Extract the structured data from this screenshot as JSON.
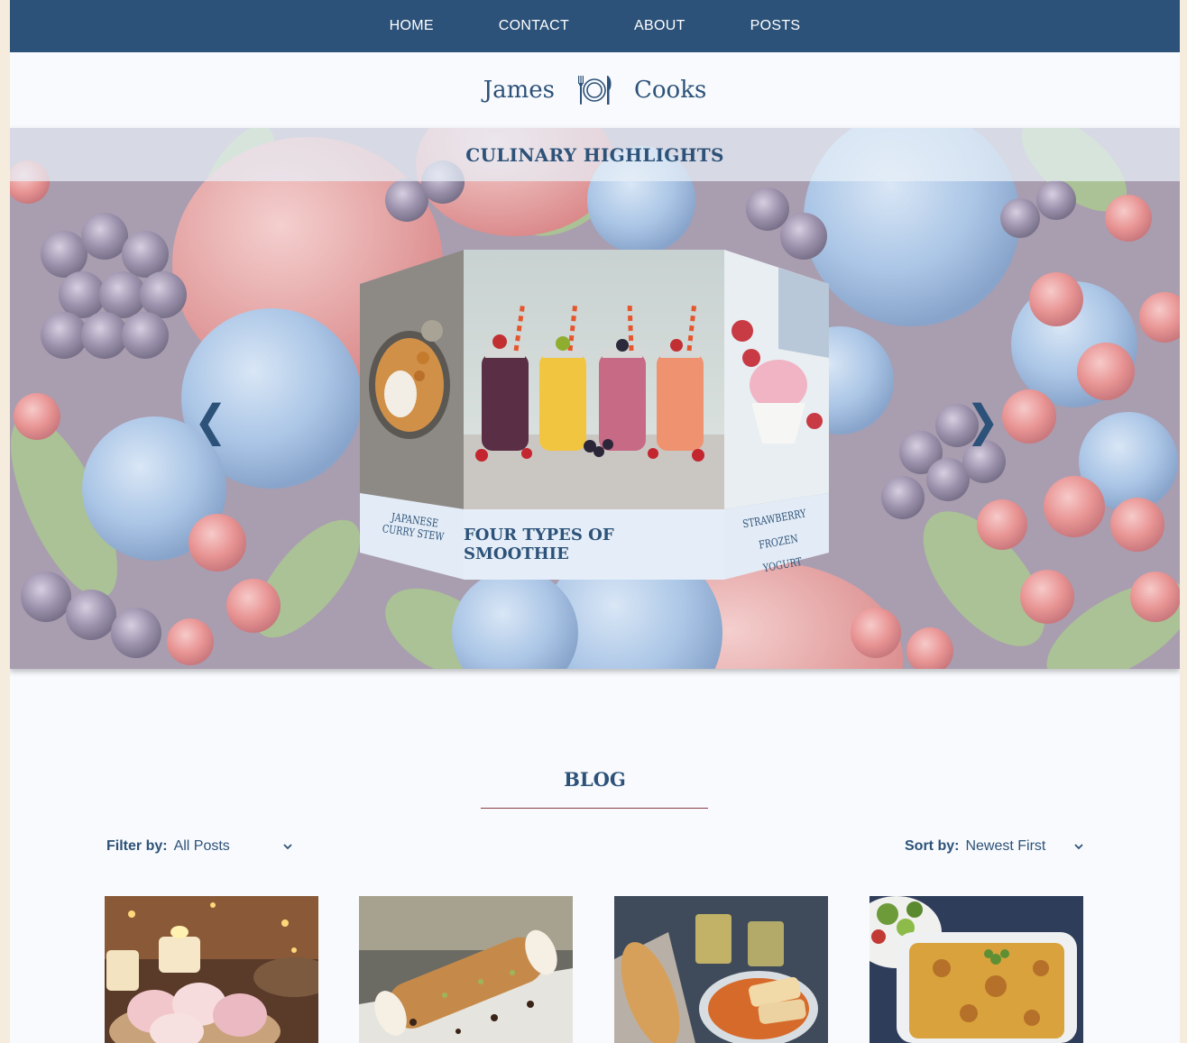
{
  "nav": {
    "items": [
      {
        "label": "HOME"
      },
      {
        "label": "CONTACT"
      },
      {
        "label": "ABOUT"
      },
      {
        "label": "POSTS"
      }
    ]
  },
  "brand": {
    "first": "James",
    "last": "Cooks",
    "icon": "plate-cutlery-icon"
  },
  "hero": {
    "title": "CULINARY HIGHLIGHTS",
    "prev_icon": "chevron-left-icon",
    "next_icon": "chevron-right-icon",
    "slides": {
      "left": {
        "caption": "JAPANESE CURRY STEW"
      },
      "center": {
        "caption": "FOUR TYPES OF SMOOTHIE"
      },
      "right": {
        "caption": "STRAWBERRY FROZEN YOGURT"
      }
    }
  },
  "blog": {
    "title": "BLOG",
    "filter": {
      "label": "Filter by:",
      "value": "All Posts"
    },
    "sort": {
      "label": "Sort by:",
      "value": "Newest First"
    },
    "posts": [
      {
        "image": "mochi-dessert-photo"
      },
      {
        "image": "cannoli-photo"
      },
      {
        "image": "bread-soup-photo"
      },
      {
        "image": "lasagna-photo"
      }
    ]
  },
  "colors": {
    "nav_bg": "#2d5279",
    "accent": "#2d5279",
    "rule": "#8a3a46",
    "page_bg": "#f8fafd",
    "outer_bg": "#f5ecdd"
  }
}
